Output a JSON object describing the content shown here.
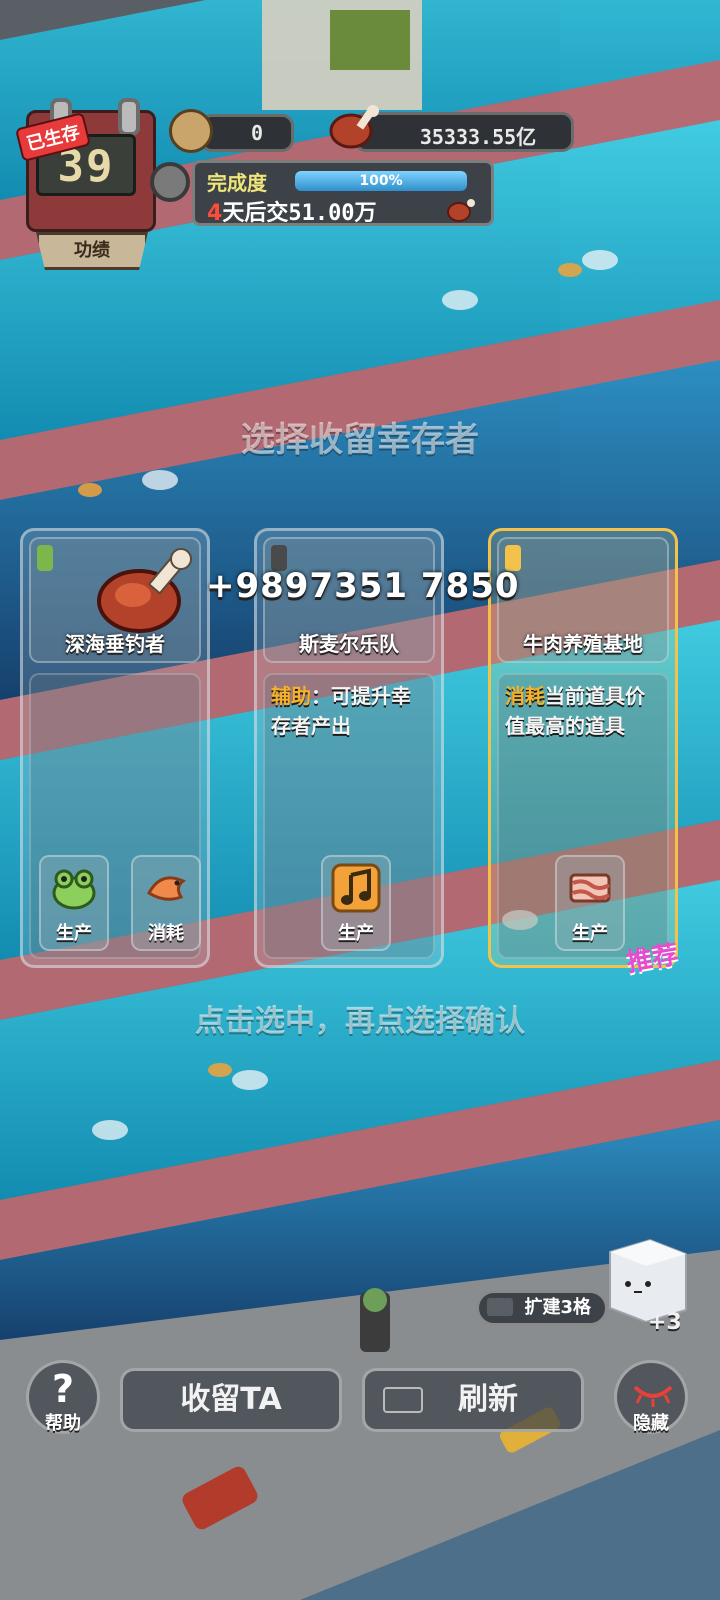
{
  "hud": {
    "survived_tag": "已生存",
    "days": "39",
    "merit_label": "功绩",
    "counter_value": "0",
    "meat_amount": "35333.55亿",
    "completion_label": "完成度",
    "completion_percent": "100%",
    "completion_fraction": 1.0,
    "deadline_days": "4",
    "deadline_text": "天后交",
    "deadline_amount": "51.00万"
  },
  "overlay": {
    "title": "选择收留幸存者",
    "hint": "点击选中，再点选择确认",
    "reward_text": "+9897351 7850",
    "recommend_tag": "推荐"
  },
  "cards": [
    {
      "name": "深海垂钓者",
      "desc_keyword": "",
      "desc_text": "",
      "slots": [
        {
          "label": "生产",
          "icon": "frog-icon"
        },
        {
          "label": "消耗",
          "icon": "shrimp-icon"
        }
      ]
    },
    {
      "name": "斯麦尔乐队",
      "desc_keyword": "辅助",
      "desc_text": "：可提升幸存者产出",
      "slots": [
        {
          "label": "生产",
          "icon": "music-note-icon"
        }
      ]
    },
    {
      "name": "牛肉养殖基地",
      "desc_keyword": "消耗",
      "desc_text": "当前道具价值最高的道具",
      "slots": [
        {
          "label": "生产",
          "icon": "bacon-icon"
        }
      ]
    }
  ],
  "bottom": {
    "help_label": "帮助",
    "adopt_label": "收留TA",
    "refresh_label": "刷新",
    "hide_label": "隐藏",
    "expand_label": "扩建3格",
    "cube_count": "+3"
  }
}
